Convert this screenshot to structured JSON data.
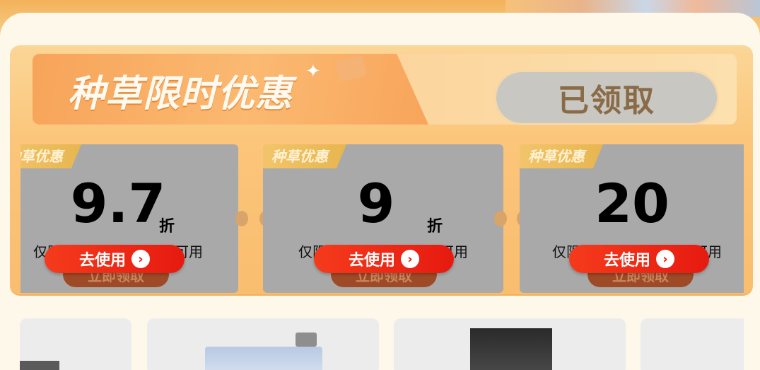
{
  "header": {
    "title": "种草限时优惠",
    "claimed_label": "已领取"
  },
  "coupons": [
    {
      "tag": "种草优惠",
      "value": "9.7",
      "unit": "折",
      "desc": "仅限老板品牌部分商品可用",
      "hidden_label": "立即领取",
      "use_label": "去使用"
    },
    {
      "tag": "种草优惠",
      "value": "9",
      "unit": "折",
      "desc": "仅限华帝品牌部分商品可用",
      "hidden_label": "立即领取",
      "use_label": "去使用"
    },
    {
      "tag": "种草优惠",
      "value": "20",
      "unit": "",
      "desc": "仅限方太品牌部分商品可用",
      "hidden_label": "立即领取",
      "use_label": "去使用"
    }
  ],
  "colors": {
    "accent_orange": "#f9bd6e",
    "use_button_red": "#e61a10",
    "card_gray": "#a9a9a9",
    "claimed_gray": "#c9c7c2"
  },
  "icons": [
    "sparkle-icon",
    "ticket-icon",
    "chevron-right-icon"
  ],
  "products": [
    {
      "image": "range-hood-partial"
    },
    {
      "image": "water-heater"
    },
    {
      "image": "range-hood-black"
    },
    {
      "image": "appliance-partial"
    }
  ]
}
